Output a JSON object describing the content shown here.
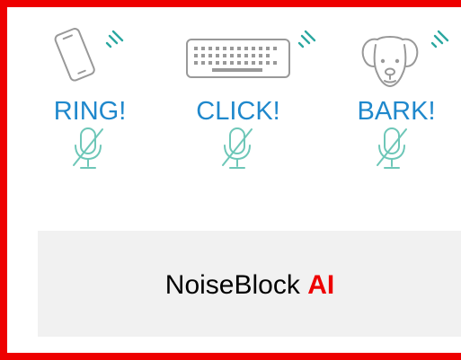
{
  "colors": {
    "frame": "#ee0000",
    "label_text": "#1f88cc",
    "icon_outline": "#999999",
    "mic": "#6ec7b8",
    "waves": "#2aa7a0",
    "brand_text": "#000000",
    "brand_accent": "#ee0000",
    "banner_bg": "#f1f1f1"
  },
  "noises": [
    {
      "icon": "phone-icon",
      "label": "RING!"
    },
    {
      "icon": "keyboard-icon",
      "label": "CLICK!"
    },
    {
      "icon": "dog-icon",
      "label": "BARK!"
    }
  ],
  "brand": {
    "name": "NoiseBlock",
    "accent": "AI"
  }
}
